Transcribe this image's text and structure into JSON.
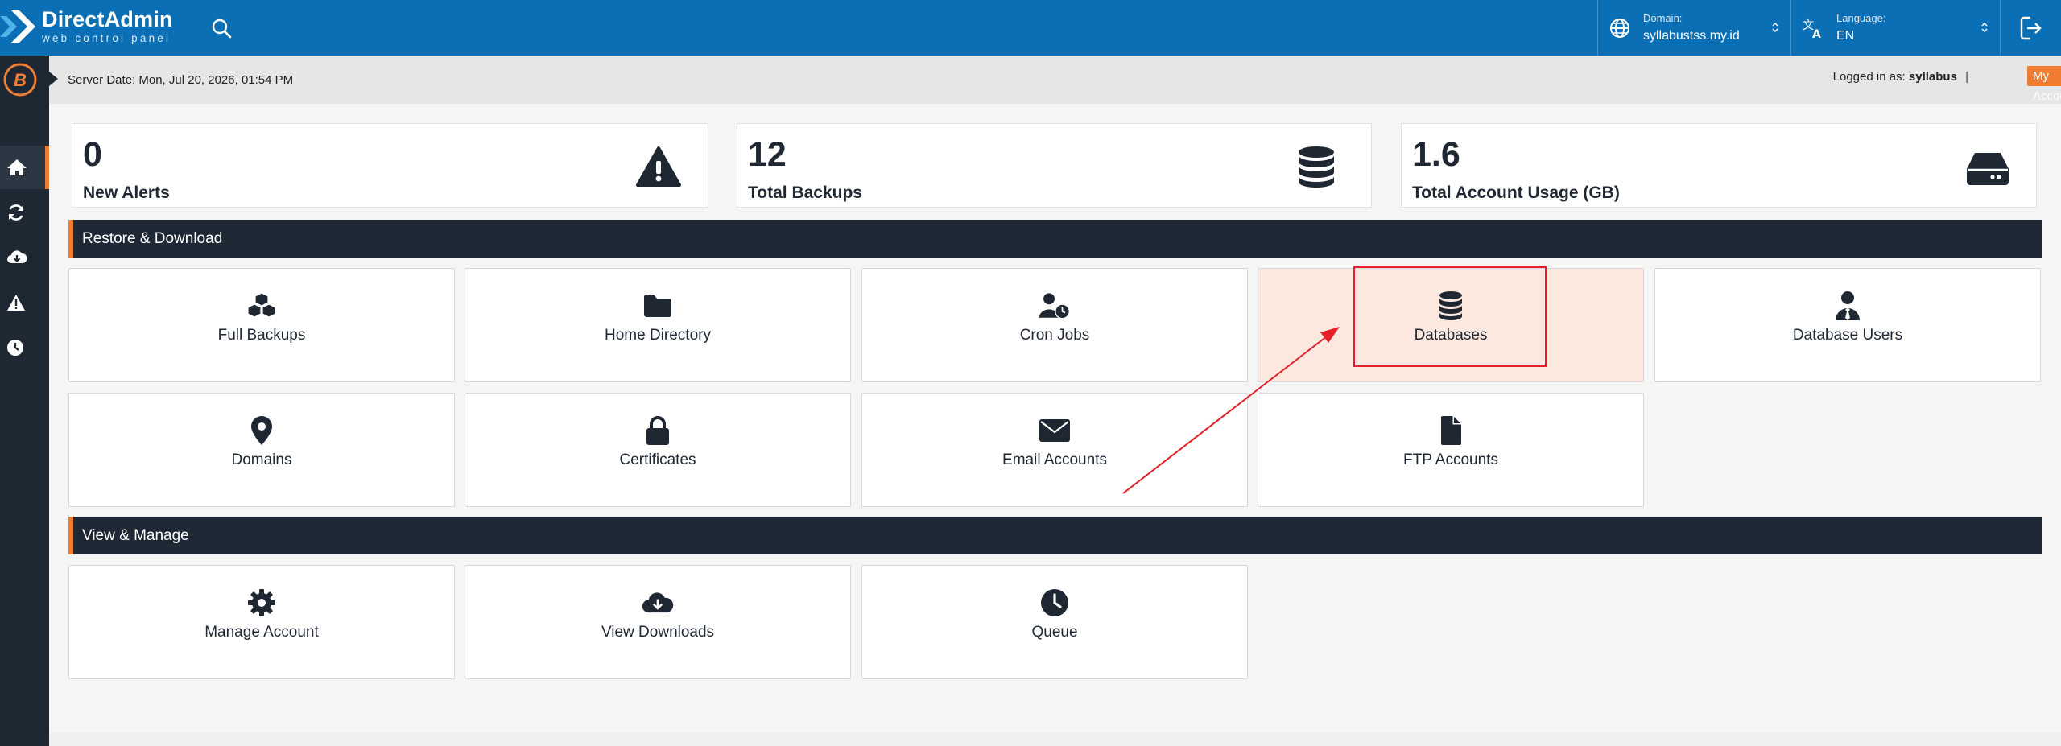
{
  "header": {
    "brand_title": "DirectAdmin",
    "brand_subtitle": "web control panel",
    "domain_label": "Domain:",
    "domain_value": "syllabustss.my.id",
    "language_label": "Language:",
    "language_value": "EN"
  },
  "serverbar": {
    "server_date": "Server Date: Mon, Jul 20, 2026, 01:54 PM",
    "logged_in_label": "Logged in as:",
    "username": "syllabus",
    "separator": "|",
    "my_account": "My Account"
  },
  "stats": [
    {
      "value": "0",
      "label": "New Alerts",
      "icon": "warning-icon"
    },
    {
      "value": "12",
      "label": "Total Backups",
      "icon": "database-icon"
    },
    {
      "value": "1.6",
      "label": "Total Account Usage (GB)",
      "icon": "hard-drive-icon"
    }
  ],
  "sections": {
    "restore": "Restore & Download",
    "view": "View & Manage"
  },
  "restore_tiles": [
    {
      "label": "Full Backups",
      "icon": "cubes-icon"
    },
    {
      "label": "Home Directory",
      "icon": "folder-icon"
    },
    {
      "label": "Cron Jobs",
      "icon": "user-clock-icon"
    },
    {
      "label": "Databases",
      "icon": "database-icon"
    },
    {
      "label": "Database Users",
      "icon": "user-tie-icon"
    },
    {
      "label": "Domains",
      "icon": "map-marker-icon"
    },
    {
      "label": "Certificates",
      "icon": "lock-icon"
    },
    {
      "label": "Email Accounts",
      "icon": "envelope-icon"
    },
    {
      "label": "FTP Accounts",
      "icon": "file-icon"
    }
  ],
  "view_tiles": [
    {
      "label": "Manage Account",
      "icon": "gear-icon"
    },
    {
      "label": "View Downloads",
      "icon": "cloud-download-icon"
    },
    {
      "label": "Queue",
      "icon": "clock-icon"
    }
  ],
  "colors": {
    "topbar": "#0a6fb4",
    "sidebar": "#1e2833",
    "accent": "#ee7e36",
    "highlight_fill": "#fde8df",
    "annotation_red": "#e5202a"
  }
}
